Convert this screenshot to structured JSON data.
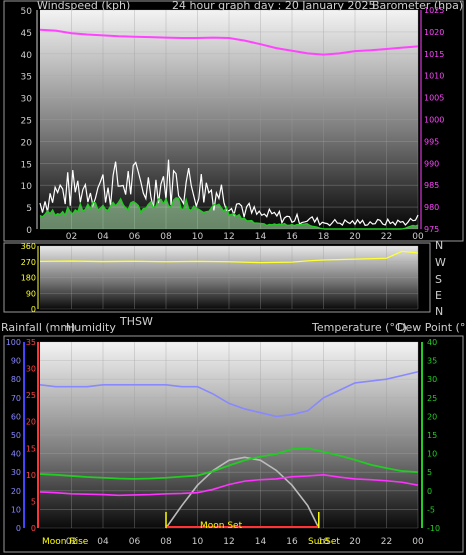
{
  "header": {
    "left": "Windspeed (kph)",
    "center": "24 hour graph day : 20 January 2025",
    "right": "Barometer (hpa)"
  },
  "middle_header": {
    "thsw": "THSW",
    "rainfall": "Rainfall (mm)",
    "humidity": "Humidity",
    "temperature": "Temperature (°C)",
    "dewpoint": "Dew Point (°C)"
  },
  "compass": [
    "N",
    "W",
    "S",
    "E",
    "N"
  ],
  "bottom_labels": {
    "moon_rise": "Moon Rise",
    "moon_set": "Moon Set",
    "sun_set": "SunSet"
  },
  "colors": {
    "barometer": "#ff44ff",
    "wind_speed": "#ffffff",
    "wind_avg": "#22cc22",
    "wind_light": "#b8f0b8",
    "direction": "#ffff33",
    "humidity": "#8888ff",
    "temperature": "#22cc22",
    "dewpoint": "#ff33ff",
    "sun": "#bbbbbb",
    "markers": "#ffff00",
    "rain_axis": "#ff3333",
    "humidity_axis": "#4444ff",
    "temp_axis": "#22cc22"
  },
  "chart_data": [
    {
      "type": "line",
      "title": "24 hour graph day : 20 January 2025",
      "xlabel": "",
      "x_ticks": [
        "02",
        "04",
        "06",
        "08",
        "10",
        "12",
        "14",
        "16",
        "18",
        "20",
        "22",
        "00"
      ],
      "xlim": [
        0,
        24
      ],
      "y_left_label": "Windspeed (kph)",
      "y_left_ticks": [
        0,
        5,
        10,
        15,
        20,
        25,
        30,
        35,
        40,
        45,
        50
      ],
      "ylim_left": [
        0,
        50
      ],
      "y_right_label": "Barometer (hpa)",
      "y_right_ticks": [
        975,
        980,
        985,
        990,
        995,
        1000,
        1005,
        1010,
        1015,
        1020,
        1025
      ],
      "ylim_right": [
        975,
        1025
      ],
      "series": [
        {
          "name": "Barometer (hpa)",
          "axis": "right",
          "x": [
            0,
            1,
            2,
            3,
            4,
            5,
            6,
            7,
            8,
            9,
            10,
            11,
            12,
            13,
            14,
            15,
            16,
            17,
            18,
            19,
            20,
            21,
            22,
            23,
            24
          ],
          "values": [
            1020.5,
            1020.3,
            1019.7,
            1019.4,
            1019.2,
            1019.0,
            1018.9,
            1018.8,
            1018.7,
            1018.6,
            1018.6,
            1018.7,
            1018.6,
            1018.0,
            1017.2,
            1016.3,
            1015.7,
            1015.1,
            1014.8,
            1015.1,
            1015.6,
            1015.8,
            1016.1,
            1016.4,
            1016.7
          ]
        },
        {
          "name": "Windspeed (kph)",
          "axis": "left",
          "x": [
            0,
            1,
            2,
            3,
            4,
            5,
            6,
            7,
            8,
            9,
            10,
            11,
            12,
            13,
            14,
            15,
            16,
            17,
            18,
            19,
            20,
            21,
            22,
            23,
            24
          ],
          "values": [
            8,
            11,
            12,
            13,
            13,
            14,
            14,
            13,
            15,
            14,
            13,
            12,
            10,
            6,
            4,
            4,
            3,
            3,
            2,
            2,
            2,
            2,
            2,
            2,
            3
          ]
        },
        {
          "name": "Average windspeed (kph)",
          "axis": "left",
          "x": [
            0,
            1,
            2,
            3,
            4,
            5,
            6,
            7,
            8,
            9,
            10,
            11,
            12,
            13,
            14,
            15,
            16,
            17,
            18,
            19,
            20,
            21,
            22,
            23,
            24
          ],
          "values": [
            3,
            4,
            4,
            5,
            5,
            6,
            5,
            5,
            6,
            6,
            5,
            5,
            4,
            2,
            1,
            1,
            1,
            1,
            0,
            0,
            0,
            0,
            0,
            0,
            1
          ]
        }
      ]
    },
    {
      "type": "line",
      "title": "",
      "x_ticks": [],
      "xlim": [
        0,
        24
      ],
      "y_left_ticks": [
        0,
        90,
        180,
        270,
        360
      ],
      "ylim_left": [
        0,
        360
      ],
      "y_right_ticks": [
        "N",
        "W",
        "S",
        "E",
        "N"
      ],
      "series": [
        {
          "name": "Wind direction",
          "axis": "left",
          "x": [
            0,
            2,
            4,
            6,
            8,
            10,
            12,
            14,
            16,
            17,
            18,
            20,
            22,
            23,
            24
          ],
          "values": [
            272,
            274,
            271,
            273,
            270,
            272,
            270,
            265,
            268,
            275,
            280,
            285,
            290,
            330,
            320
          ]
        }
      ]
    },
    {
      "type": "line",
      "title": "",
      "x_ticks": [
        "02",
        "04",
        "06",
        "08",
        "10",
        "12",
        "14",
        "16",
        "18",
        "20",
        "22",
        "00"
      ],
      "xlim": [
        0,
        24
      ],
      "y_left_label": "Humidity",
      "y_left_ticks": [
        0,
        10,
        20,
        30,
        40,
        50,
        60,
        70,
        80,
        90,
        100
      ],
      "ylim_left": [
        0,
        100
      ],
      "y_rain_label": "Rainfall (mm)",
      "y_rain_ticks": [
        0,
        5,
        10,
        15,
        20,
        25,
        30,
        35
      ],
      "ylim_rain": [
        0,
        35
      ],
      "y_right_label": "Temperature (°C)",
      "y_right_ticks": [
        -10,
        -5,
        0,
        5,
        10,
        15,
        20,
        25,
        30,
        35,
        40
      ],
      "ylim_right": [
        -10,
        40
      ],
      "series": [
        {
          "name": "Humidity",
          "axis": "left",
          "x": [
            0,
            1,
            2,
            3,
            4,
            5,
            6,
            7,
            8,
            9,
            10,
            11,
            12,
            13,
            14,
            15,
            16,
            17,
            18,
            19,
            20,
            21,
            22,
            23,
            24
          ],
          "values": [
            77,
            76,
            76,
            76,
            77,
            77,
            77,
            77,
            77,
            76,
            76,
            72,
            67,
            64,
            62,
            60,
            61,
            63,
            70,
            74,
            78,
            79,
            80,
            82,
            84
          ]
        },
        {
          "name": "Temperature (°C)",
          "axis": "right",
          "x": [
            0,
            1,
            2,
            3,
            4,
            5,
            6,
            7,
            8,
            9,
            10,
            11,
            12,
            13,
            14,
            15,
            16,
            17,
            18,
            19,
            20,
            21,
            22,
            23,
            24
          ],
          "values": [
            4.5,
            4.3,
            4.0,
            3.7,
            3.5,
            3.3,
            3.2,
            3.3,
            3.5,
            3.8,
            4.1,
            5.3,
            6.8,
            8.2,
            9.2,
            9.9,
            11.2,
            11.4,
            10.5,
            9.5,
            8.3,
            7.0,
            6.1,
            5.3,
            5.0
          ]
        },
        {
          "name": "Dew Point (°C)",
          "axis": "right",
          "x": [
            0,
            1,
            2,
            3,
            4,
            5,
            6,
            7,
            8,
            9,
            10,
            11,
            12,
            13,
            14,
            15,
            16,
            17,
            18,
            19,
            20,
            21,
            22,
            23,
            24
          ],
          "values": [
            -0.3,
            -0.5,
            -0.8,
            -0.9,
            -1.0,
            -1.2,
            -1.1,
            -1.0,
            -0.8,
            -0.7,
            -0.5,
            0.4,
            1.7,
            2.6,
            3.0,
            3.2,
            3.8,
            4.0,
            4.3,
            3.7,
            3.2,
            3.0,
            2.7,
            2.3,
            1.5
          ]
        },
        {
          "name": "Solar",
          "axis": "right",
          "x": [
            8.0,
            9,
            10,
            11,
            12,
            13,
            14,
            15,
            16,
            17,
            17.7
          ],
          "values": [
            -10,
            -4,
            1.5,
            5.5,
            8.2,
            9.0,
            8.2,
            5.5,
            1.5,
            -4,
            -10
          ]
        }
      ]
    }
  ]
}
